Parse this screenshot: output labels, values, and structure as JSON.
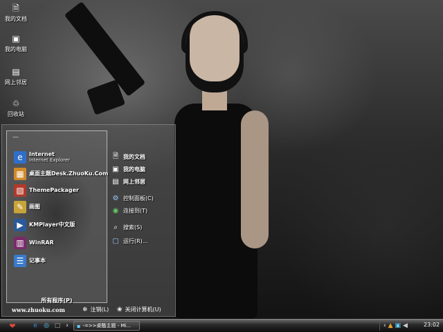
{
  "desktop": {
    "icons": [
      {
        "label": "我的文档",
        "icon": "documents-icon"
      },
      {
        "label": "我的电脑",
        "icon": "computer-icon"
      },
      {
        "label": "网上邻居",
        "icon": "network-icon"
      },
      {
        "label": "回收站",
        "icon": "recycle-bin-icon"
      }
    ]
  },
  "start_menu": {
    "pinned": [
      {
        "label": "Internet",
        "sublabel": "Internet Explorer",
        "icon": "internet-explorer-icon"
      },
      {
        "label": "桌面主题Desk.ZhuoKu.Com",
        "icon": "theme-icon"
      },
      {
        "label": "ThemePackager",
        "icon": "packager-icon"
      },
      {
        "label": "画图",
        "icon": "paint-icon"
      },
      {
        "label": "KMPlayer中文版",
        "icon": "kmplayer-icon"
      },
      {
        "label": "WinRAR",
        "icon": "winrar-icon"
      },
      {
        "label": "记事本",
        "icon": "notepad-icon"
      }
    ],
    "all_programs": "所有程序(P)",
    "places": [
      {
        "label": "我的文档",
        "icon": "documents-icon",
        "bold": true
      },
      {
        "label": "我的电脑",
        "icon": "computer-icon",
        "bold": true
      },
      {
        "label": "网上邻居",
        "icon": "network-icon",
        "bold": true
      },
      {
        "label": "控制面板(C)",
        "icon": "control-panel-icon",
        "bold": false
      },
      {
        "label": "连接到(T)",
        "icon": "connect-icon",
        "bold": false
      },
      {
        "label": "搜索(S)",
        "icon": "search-icon",
        "bold": false
      },
      {
        "label": "运行(R)...",
        "icon": "run-icon",
        "bold": false
      }
    ],
    "footer": {
      "site": "www.zhuoku.com",
      "logoff": "注销(L)",
      "shutdown": "关闭计算机(U)"
    }
  },
  "taskbar": {
    "task_title": "-=>>桌酷主题 - Mi...",
    "clock": "23:02"
  },
  "colors": {
    "start_button": "#d94a3a",
    "accent_blue": "#3a8ee6"
  }
}
